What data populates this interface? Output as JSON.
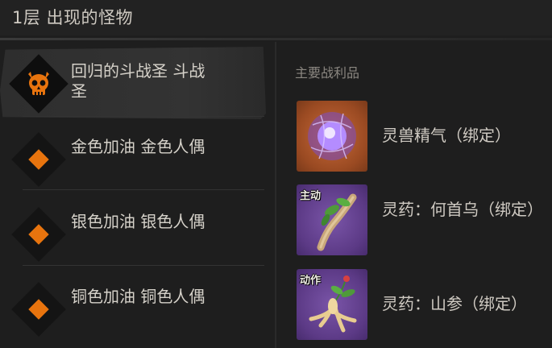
{
  "header": {
    "title": "1层 出现的怪物"
  },
  "monsters": [
    {
      "name": "回归的斗战圣 斗战圣",
      "icon": "skull-icon",
      "selected": true
    },
    {
      "name": "金色加油 金色人偶",
      "icon": "orange-diamond-icon",
      "selected": false
    },
    {
      "name": "银色加油 银色人偶",
      "icon": "orange-diamond-icon",
      "selected": false
    },
    {
      "name": "铜色加油 铜色人偶",
      "icon": "orange-diamond-icon",
      "selected": false
    }
  ],
  "loot": {
    "title": "主要战利品",
    "items": [
      {
        "name": "灵兽精气（绑定）",
        "tag": "",
        "icon": "purple-energy-orb-icon"
      },
      {
        "name": "灵药：何首乌（绑定）",
        "tag": "主动",
        "icon": "heshouwu-root-icon"
      },
      {
        "name": "灵药：山参（绑定）",
        "tag": "动作",
        "icon": "ginseng-root-icon"
      }
    ]
  },
  "colors": {
    "accent": "#e8740e",
    "background": "#1e1e1e"
  }
}
